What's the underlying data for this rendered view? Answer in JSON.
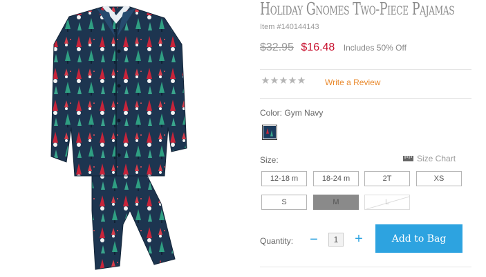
{
  "product": {
    "title": "Holiday Gnomes Two-Piece Pajamas",
    "item_number": "Item #140144143",
    "price_original": "$32.95",
    "price_sale": "$16.48",
    "discount_text": "Includes 50% Off"
  },
  "review": {
    "rating": 0,
    "rating_max": 5,
    "write_review_label": "Write a Review"
  },
  "color": {
    "label": "Color:",
    "selected_name": "Gym Navy",
    "swatch_color": "#1a3a5c",
    "swatch_icon": "gnome-pattern-swatch"
  },
  "size": {
    "label": "Size:",
    "chart_label": "Size Chart",
    "options": [
      {
        "label": "12-18 m",
        "state": "available"
      },
      {
        "label": "18-24 m",
        "state": "available"
      },
      {
        "label": "2T",
        "state": "available"
      },
      {
        "label": "XS",
        "state": "available"
      },
      {
        "label": "S",
        "state": "available"
      },
      {
        "label": "M",
        "state": "selected"
      },
      {
        "label": "L",
        "state": "unavailable"
      }
    ]
  },
  "quantity": {
    "label": "Quantity:",
    "value": "1",
    "minus_symbol": "−",
    "plus_symbol": "+"
  },
  "cart": {
    "add_to_bag_label": "Add to Bag"
  },
  "colors": {
    "accent_blue": "#2da3e0",
    "sale_red": "#c8102e",
    "review_orange": "#e9892c",
    "fabric_navy": "#1d3550"
  }
}
